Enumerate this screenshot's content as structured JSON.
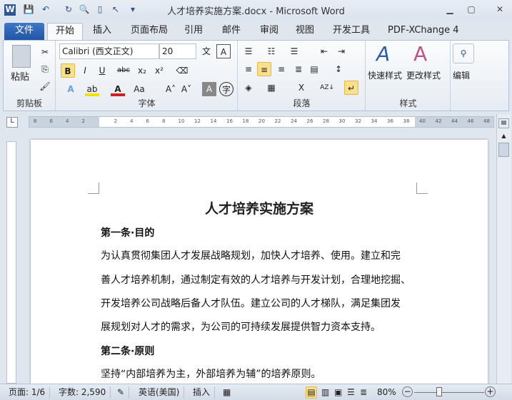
{
  "window": {
    "title": "人才培养实施方案.docx - Microsoft Word"
  },
  "tabs": [
    "文件",
    "开始",
    "插入",
    "页面布局",
    "引用",
    "邮件",
    "审阅",
    "视图",
    "开发工具",
    "PDF-XChange 4"
  ],
  "ribbon": {
    "clipboard": {
      "label": "剪贴板",
      "paste": "粘贴"
    },
    "font": {
      "label": "字体",
      "font_name": "Calibri (西文正文)",
      "font_size": "20"
    },
    "paragraph": {
      "label": "段落"
    },
    "styles": {
      "label": "样式",
      "quick": "快速样式",
      "change": "更改样式"
    },
    "editing": {
      "label": "编辑"
    }
  },
  "ruler": {
    "ticks": [
      "8",
      "6",
      "4",
      "2",
      "",
      "2",
      "4",
      "6",
      "8",
      "10",
      "12",
      "14",
      "16",
      "18",
      "20",
      "22",
      "24",
      "26",
      "28",
      "30",
      "32",
      "34",
      "36",
      "38",
      "40",
      "42",
      "44",
      "46",
      "48"
    ]
  },
  "document": {
    "title": "人才培养实施方案",
    "lines": [
      {
        "text": "第一条·目的",
        "bold": true
      },
      {
        "text": "为认真贯彻集团人才发展战略规划，加快人才培养、使用。建立和完"
      },
      {
        "text": "善人才培养机制，通过制定有效的人才培养与开发计划，合理地挖掘、"
      },
      {
        "text": "开发培养公司战略后备人才队伍。建立公司的人才梯队，满足集团发"
      },
      {
        "text": "展规划对人才的需求，为公司的可持续发展提供智力资本支持。"
      },
      {
        "text": "第二条·原则",
        "bold": true
      },
      {
        "text": "坚持“内部培养为主，外部培养为辅”的培养原则。"
      }
    ]
  },
  "status": {
    "page": "页面: 1/6",
    "words": "字数: 2,590",
    "language": "英语(美国)",
    "mode": "插入",
    "zoom": "80%",
    "zoom_value": 80
  }
}
